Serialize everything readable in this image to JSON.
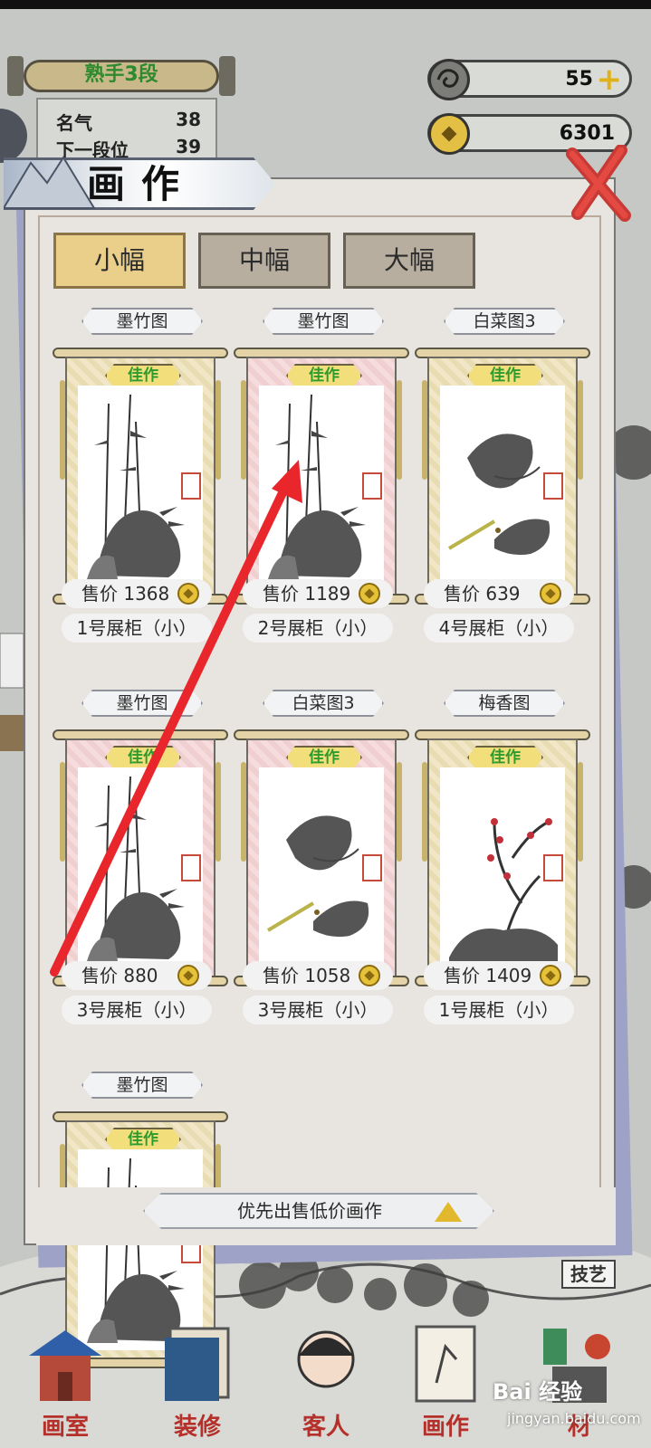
{
  "rank": {
    "title": "熟手3段"
  },
  "stats": [
    {
      "label": "名气",
      "value": "38"
    },
    {
      "label": "下一段位",
      "value": "39"
    }
  ],
  "resources": {
    "energy": "55",
    "coins": "6301"
  },
  "title": "画作",
  "tabs": [
    "小幅",
    "中幅",
    "大幅"
  ],
  "paintings": [
    {
      "name": "墨竹图",
      "grade": "佳作",
      "price": "售价 1368",
      "cabinet": "1号展柜（小）",
      "style": "cream",
      "art": "bamboo"
    },
    {
      "name": "墨竹图",
      "grade": "佳作",
      "price": "售价 1189",
      "cabinet": "2号展柜（小）",
      "style": "pink",
      "art": "bamboo"
    },
    {
      "name": "白菜图3",
      "grade": "佳作",
      "price": "售价 639",
      "cabinet": "4号展柜（小）",
      "style": "cream",
      "art": "cabbage"
    },
    {
      "name": "墨竹图",
      "grade": "佳作",
      "price": "售价 880",
      "cabinet": "3号展柜（小）",
      "style": "pink",
      "art": "bamboo"
    },
    {
      "name": "白菜图3",
      "grade": "佳作",
      "price": "售价 1058",
      "cabinet": "3号展柜（小）",
      "style": "pink",
      "art": "cabbage"
    },
    {
      "name": "梅香图",
      "grade": "佳作",
      "price": "售价 1409",
      "cabinet": "1号展柜（小）",
      "style": "cream",
      "art": "plum"
    },
    {
      "name": "墨竹图",
      "grade": "佳作",
      "price": "",
      "cabinet": "",
      "style": "cream",
      "art": "bamboo"
    }
  ],
  "sort_button": "优先出售低价画作",
  "skill": "技艺",
  "nav": [
    "画室",
    "装修",
    "客人",
    "画作",
    "材"
  ],
  "watermark": {
    "brand": "Bai 经验",
    "url": "jingyan.baidu.com"
  },
  "colors": {
    "grade_text": "#2c9a2c",
    "active_tab": "#e9cf8a",
    "arrow": "#e8262b",
    "nav_label": "#b5302a"
  }
}
